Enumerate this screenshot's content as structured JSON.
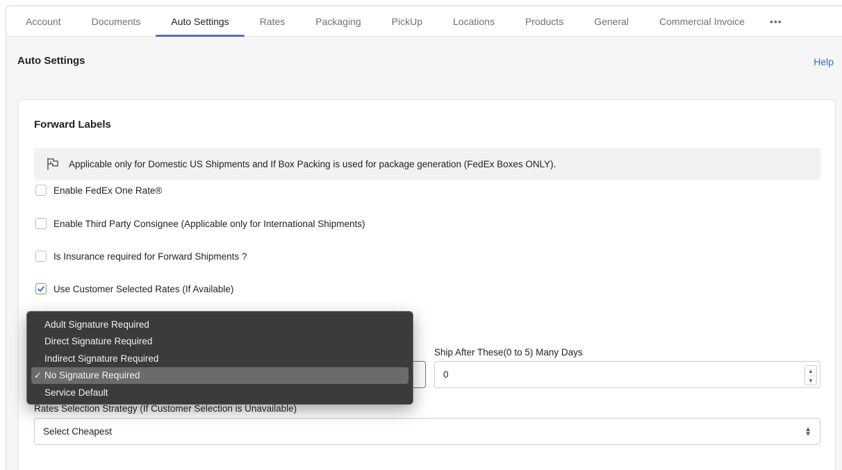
{
  "tabs": [
    {
      "label": "Account"
    },
    {
      "label": "Documents"
    },
    {
      "label": "Auto Settings",
      "active": true
    },
    {
      "label": "Rates"
    },
    {
      "label": "Packaging"
    },
    {
      "label": "PickUp"
    },
    {
      "label": "Locations"
    },
    {
      "label": "Products"
    },
    {
      "label": "General"
    },
    {
      "label": "Commercial Invoice"
    }
  ],
  "more_label": "•••",
  "page": {
    "title": "Auto Settings",
    "help_label": "Help"
  },
  "card": {
    "title": "Forward Labels",
    "banner": {
      "icon": "flag-icon",
      "text": "Applicable only for Domestic US Shipments and If Box Packing is used for package generation (FedEx Boxes ONLY)."
    },
    "checkboxes": [
      {
        "label": "Enable FedEx One Rate®",
        "checked": false
      },
      {
        "label": "Enable Third Party Consignee (Applicable only for International Shipments)",
        "checked": false
      },
      {
        "label": "Is Insurance required for Forward Shipments ?",
        "checked": false
      },
      {
        "label": "Use Customer Selected Rates (If Available)",
        "checked": true
      }
    ],
    "ship_after": {
      "label": "Ship After These(0 to 5) Many Days",
      "value": "0"
    },
    "rates_strategy": {
      "label": "Rates Selection Strategy (If Customer Selection is Unavailable)",
      "value": "Select Cheapest"
    },
    "signature_dropdown": {
      "options": [
        {
          "label": "Adult Signature Required",
          "selected": false
        },
        {
          "label": "Direct Signature Required",
          "selected": false
        },
        {
          "label": "Indirect Signature Required",
          "selected": false
        },
        {
          "label": "No Signature Required",
          "selected": true
        },
        {
          "label": "Service Default",
          "selected": false
        }
      ],
      "check_mark": "✓"
    }
  },
  "colors": {
    "accent": "#5c6ac4",
    "link": "#2c6ecb",
    "dropdown_bg": "#3b3b3d",
    "dropdown_selected": "#6b6b6e"
  }
}
